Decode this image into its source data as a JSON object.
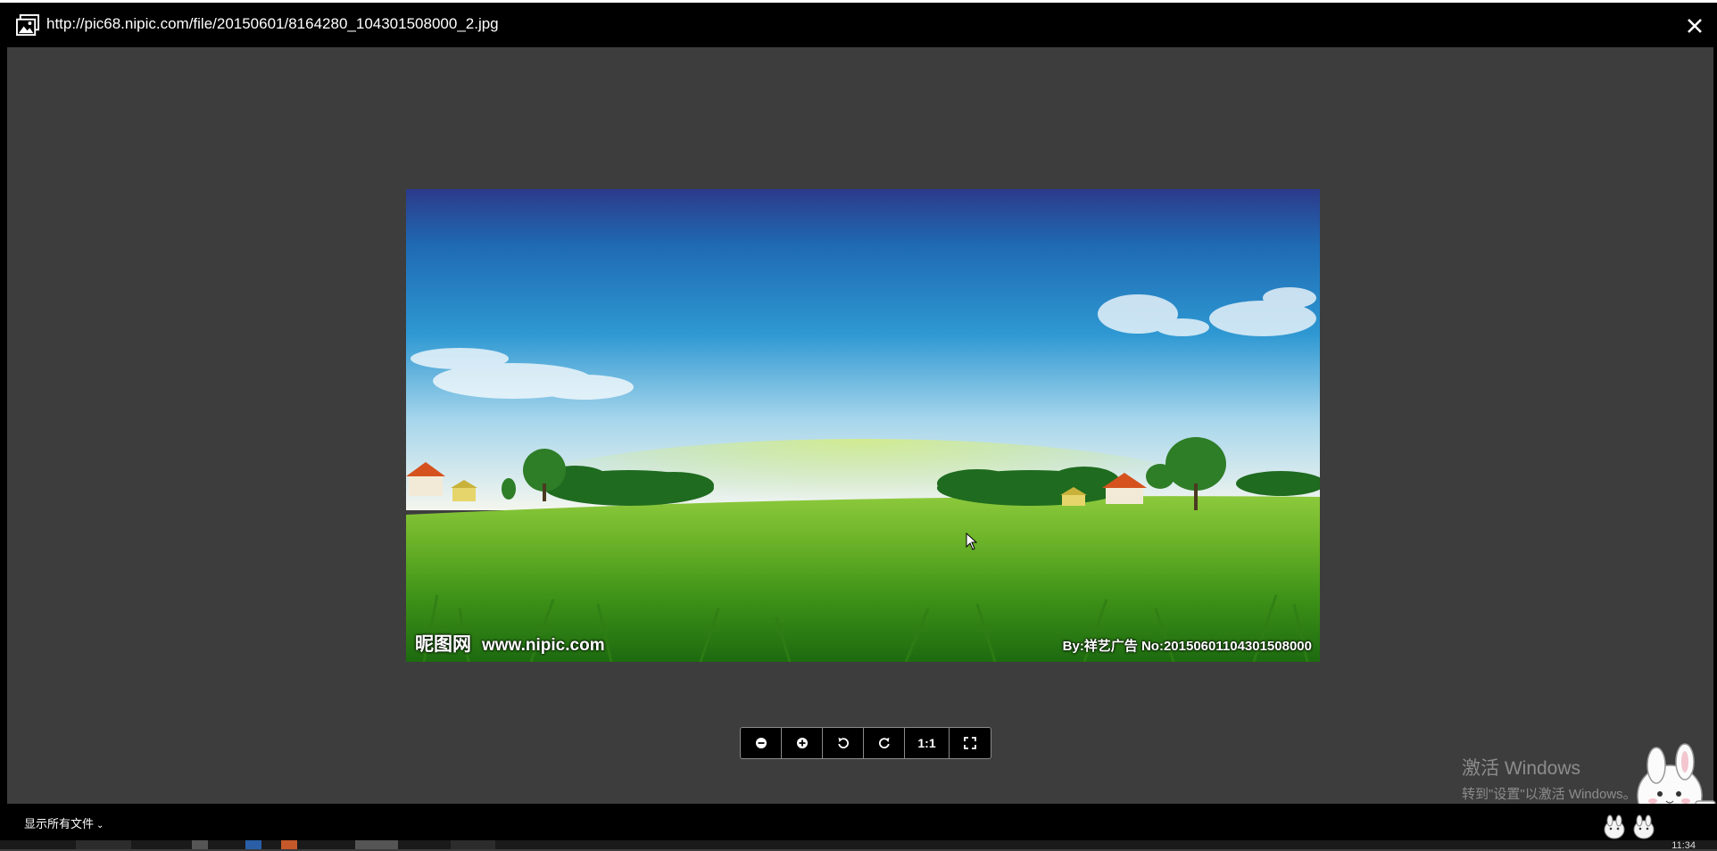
{
  "window": {
    "title": "http://pic68.nipic.com/file/20150601/8164280_104301508000_2.jpg",
    "title_icon": "image-icon",
    "close_icon": "close-icon"
  },
  "image": {
    "watermark_left_brand": "昵图网",
    "watermark_left_site": "www.nipic.com",
    "watermark_right": "By:祥艺广告 No:20150601104301508000"
  },
  "toolbar": {
    "buttons": [
      {
        "name": "zoom-out",
        "icon": "zoom-out-icon"
      },
      {
        "name": "zoom-in",
        "icon": "zoom-in-icon"
      },
      {
        "name": "rotate-left",
        "icon": "rotate-left-icon"
      },
      {
        "name": "rotate-right",
        "icon": "rotate-right-icon"
      },
      {
        "name": "actual-size",
        "label": "1:1"
      },
      {
        "name": "fullscreen",
        "icon": "fullscreen-icon"
      }
    ]
  },
  "activation_watermark": {
    "line1": "激活 Windows",
    "line2": "转到\"设置\"以激活 Windows。"
  },
  "bottom_bar": {
    "show_all_files": "显示所有文件",
    "chevron_icon": "chevron-down-icon"
  },
  "taskbar": {
    "clock": "11:34"
  },
  "colors": {
    "background": "#3d3d3d",
    "titlebar": "#000000",
    "toolbar_bg": "#000000",
    "toolbar_border": "#8a8a8a"
  }
}
